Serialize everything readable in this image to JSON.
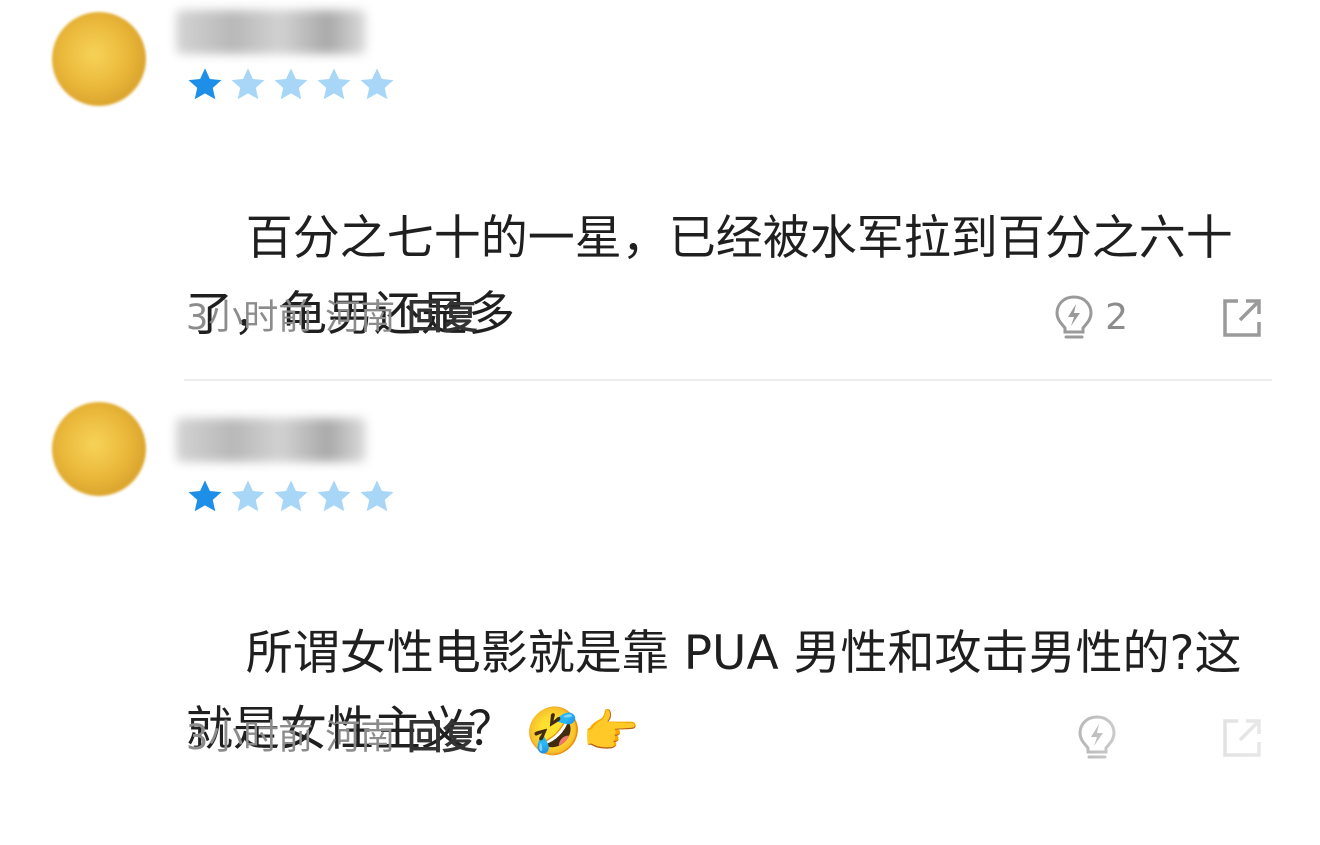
{
  "colors": {
    "star_active": "#1e8fe8",
    "star_inactive": "#a7d6f7",
    "meta_text": "#8c8c8c",
    "reply_text": "#333333"
  },
  "comments": [
    {
      "username": "",
      "rating": 1,
      "rating_max": 5,
      "text": "百分之七十的一星，已经被水军拉到百分之六十了，龟男还是多",
      "emoji": "",
      "time": "3小时前",
      "location": "河南",
      "reply_label": "回复",
      "like_count": "2",
      "icons": {
        "avatar": "avatar-image",
        "like": "lightning-bulb-icon",
        "share": "share-out-icon"
      }
    },
    {
      "username": "",
      "rating": 1,
      "rating_max": 5,
      "text": "所谓女性电影就是靠 PUA 男性和攻击男性的?这就是女性主义？",
      "emoji": "🤣👉",
      "time": "3小时前",
      "location": "河南",
      "reply_label": "回复",
      "like_count": "",
      "icons": {
        "avatar": "avatar-image",
        "like": "lightning-bulb-icon",
        "share": "share-out-icon"
      }
    }
  ]
}
